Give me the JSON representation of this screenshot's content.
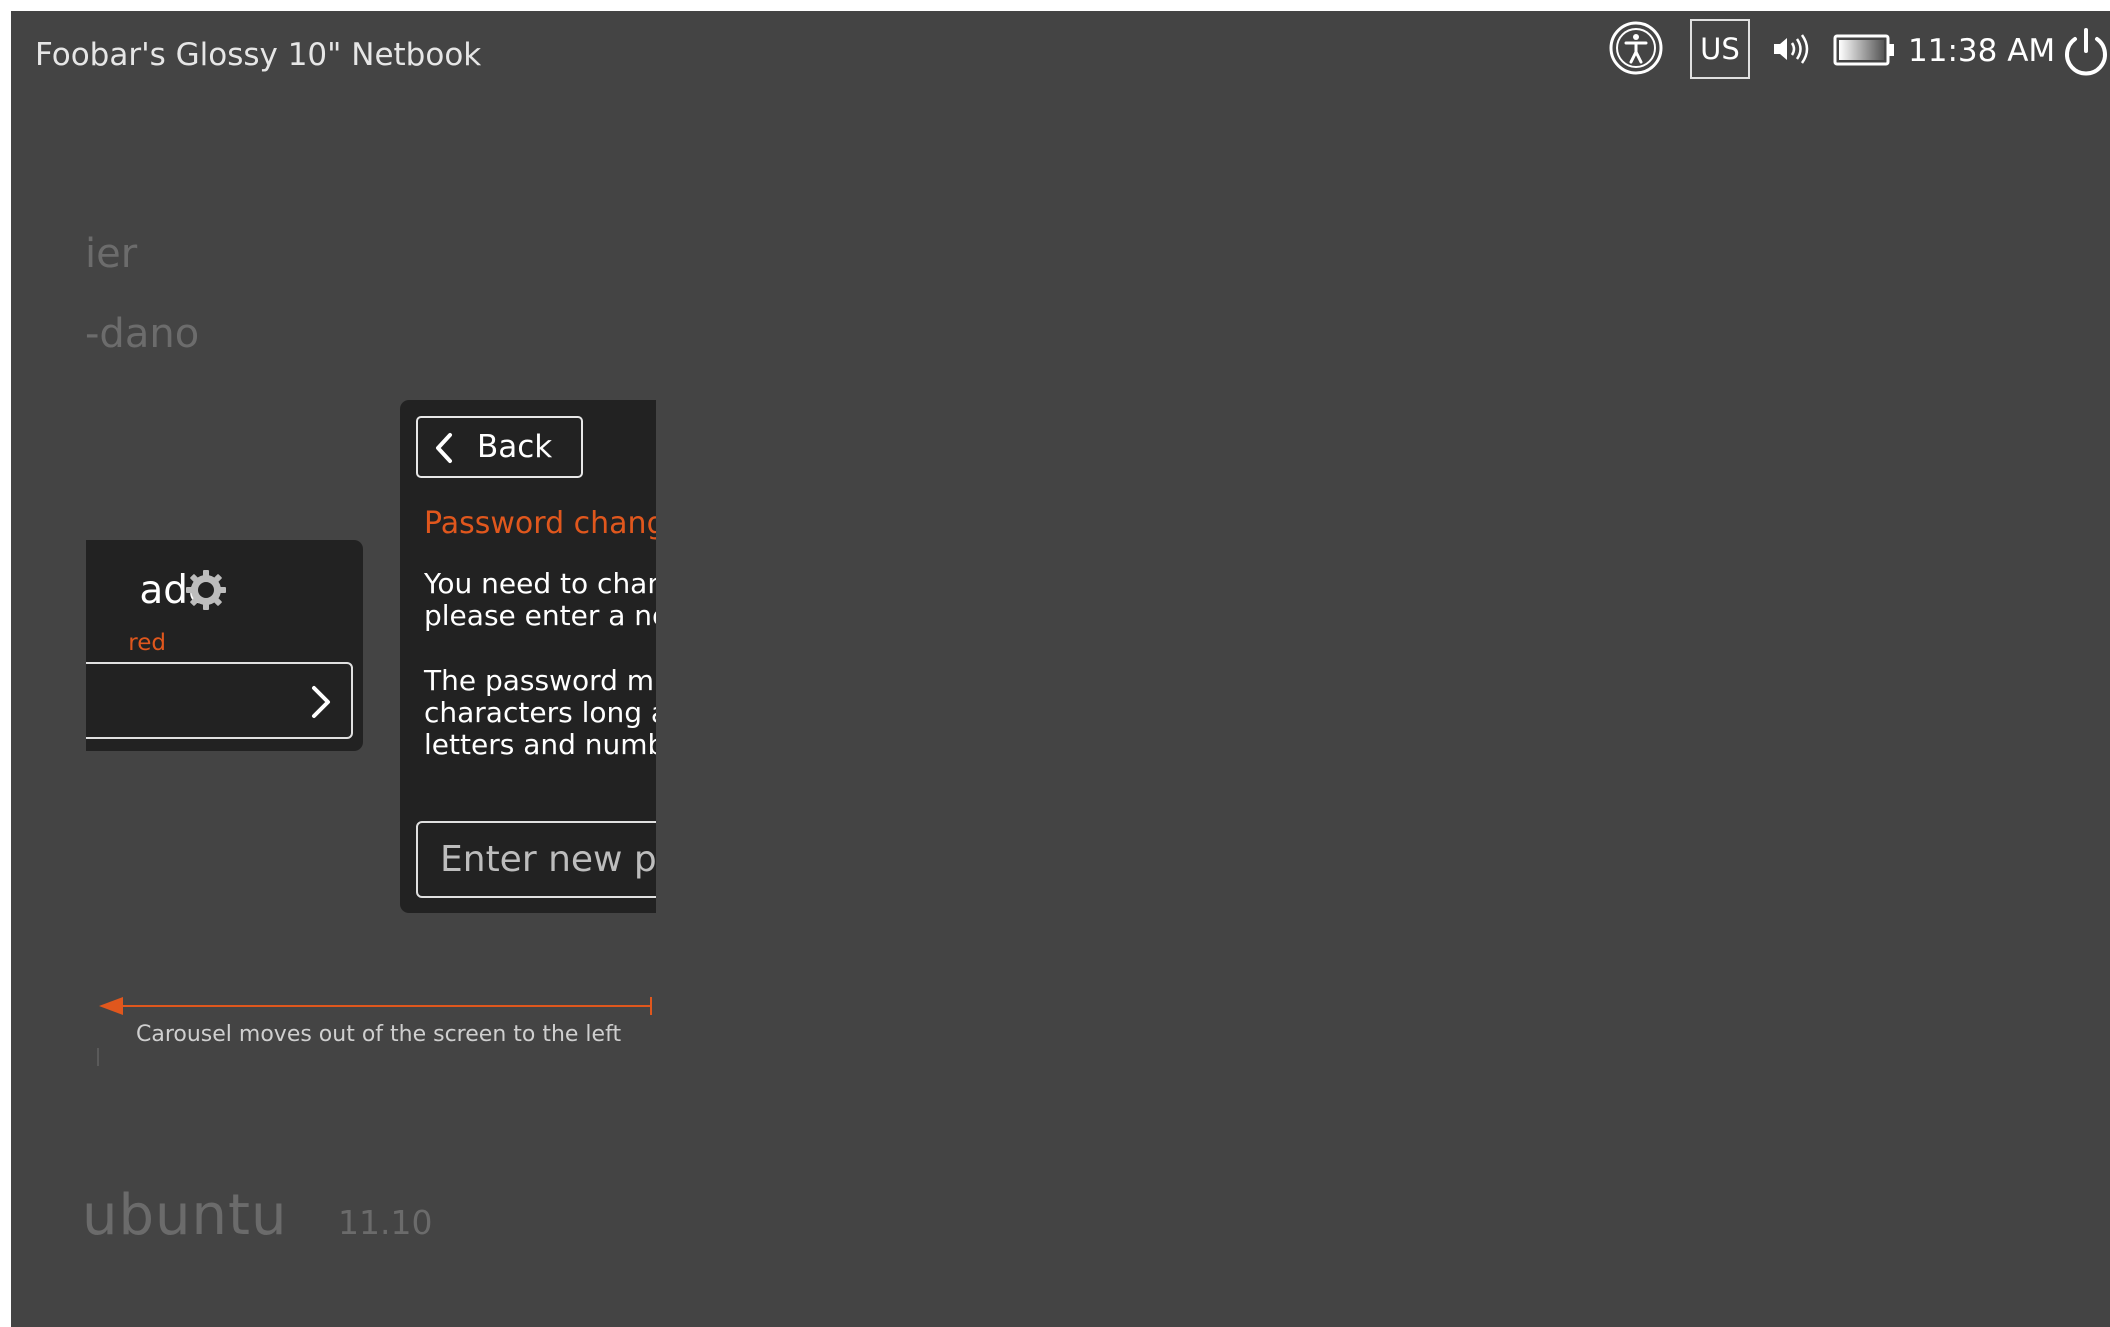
{
  "panel": {
    "hostname": "Foobar's Glossy 10\" Netbook",
    "keyboard_layout": "US",
    "clock": "11:38 AM",
    "icons": [
      "accessibility-icon",
      "volume-icon",
      "battery-icon",
      "power-icon"
    ]
  },
  "user_list": {
    "ghost_users": [
      "ier",
      "-dano"
    ],
    "selected_user": {
      "name_fragment": "ade",
      "status_fragment": "red"
    }
  },
  "password_card": {
    "back_label": "Back",
    "title": "Password chang",
    "message_lines": [
      "You need to chan",
      "please enter a ne"
    ],
    "requirement_lines": [
      "The password mu",
      "characters long ar",
      "letters and numb"
    ],
    "input_placeholder": "Enter new pa"
  },
  "annotation": {
    "text": "Carousel moves out of the screen to the left"
  },
  "brand": {
    "logo_text": "ubuntu",
    "version": "11.10"
  },
  "colors": {
    "accent": "#e0571d",
    "background": "#444444",
    "card": "#222222"
  }
}
